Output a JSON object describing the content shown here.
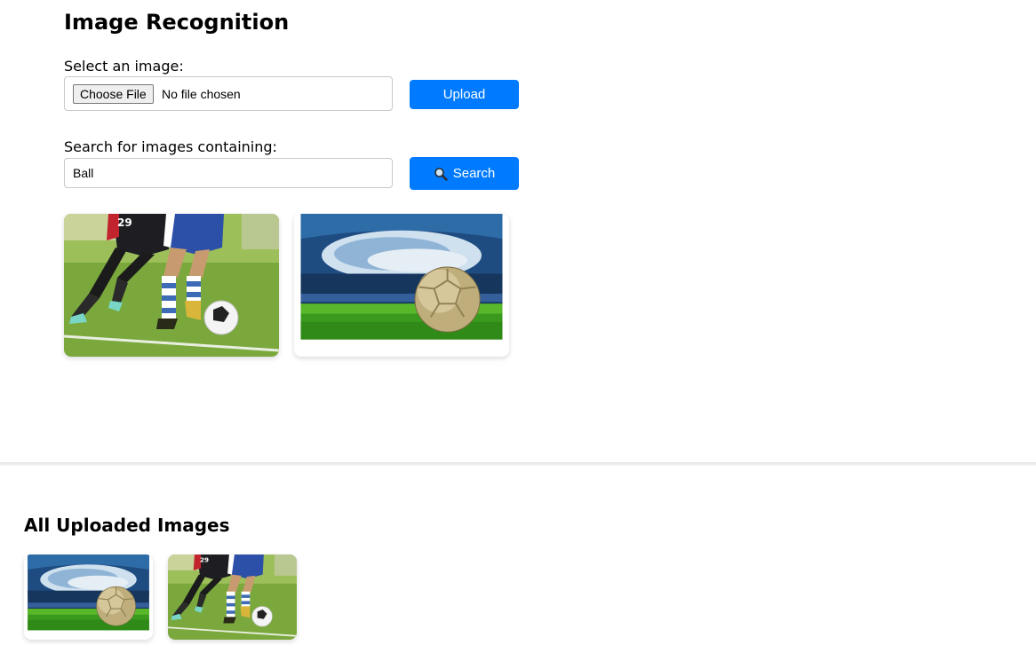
{
  "page": {
    "title": "Image Recognition"
  },
  "upload": {
    "label": "Select an image:",
    "choose_file_label": "Choose File",
    "file_status": "No file chosen",
    "upload_button": "Upload"
  },
  "search": {
    "label": "Search for images containing:",
    "query": "Ball",
    "search_button": "Search",
    "icon": "magnifier-icon"
  },
  "results": [
    {
      "image": "soccer-players-legs-ball"
    },
    {
      "image": "soccer-ball-stadium"
    }
  ],
  "all_uploaded": {
    "title": "All Uploaded Images",
    "images": [
      {
        "image": "soccer-ball-stadium"
      },
      {
        "image": "soccer-players-legs-ball"
      }
    ]
  },
  "colors": {
    "accent": "#007bff",
    "grass": "#5f9a2c",
    "sky": "#2b5a8c"
  }
}
